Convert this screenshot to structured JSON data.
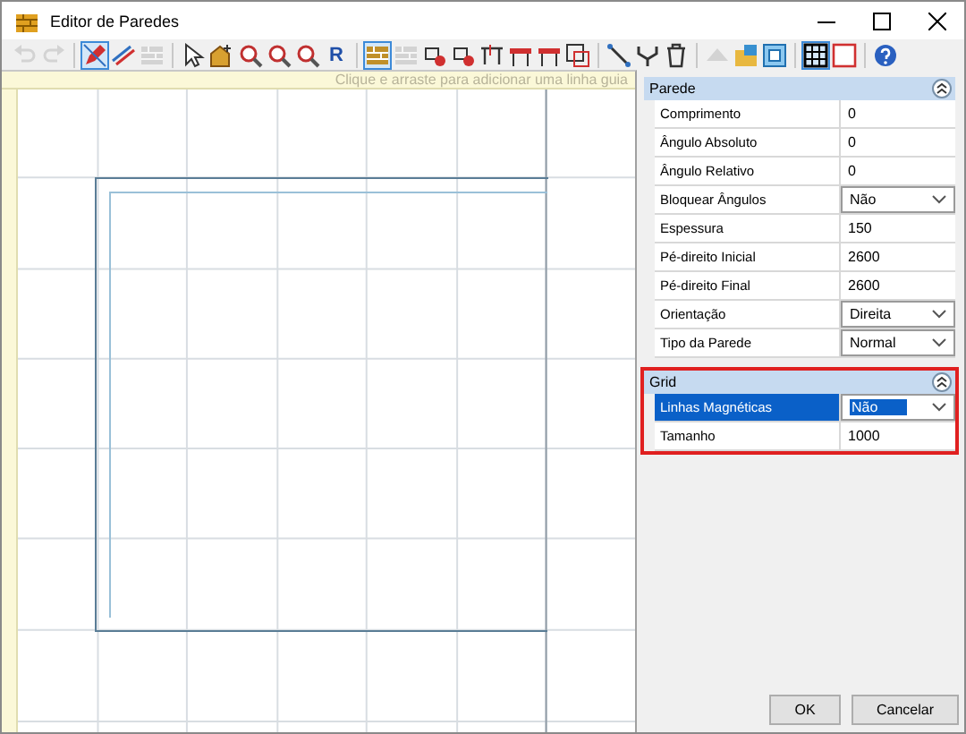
{
  "window": {
    "title": "Editor de Paredes"
  },
  "toolbar": [
    {
      "selected": false,
      "disabled": true
    },
    {
      "selected": false,
      "disabled": true
    },
    {
      "selected": true,
      "disabled": false
    },
    {
      "selected": false,
      "disabled": false
    },
    {
      "selected": false,
      "disabled": true
    },
    {
      "selected": false,
      "disabled": false
    },
    {
      "selected": false,
      "disabled": false
    },
    {
      "selected": false,
      "disabled": false
    },
    {
      "selected": false,
      "disabled": false
    },
    {
      "selected": false,
      "disabled": false
    },
    {
      "selected": false,
      "disabled": false,
      "label": "R"
    },
    {
      "selected": true,
      "disabled": false
    },
    {
      "selected": false,
      "disabled": true
    },
    {
      "selected": false,
      "disabled": false
    },
    {
      "selected": false,
      "disabled": false
    },
    {
      "selected": false,
      "disabled": false
    },
    {
      "selected": false,
      "disabled": false
    },
    {
      "selected": false,
      "disabled": false
    },
    {
      "selected": false,
      "disabled": false
    },
    {
      "selected": false,
      "disabled": false
    },
    {
      "selected": false,
      "disabled": false
    },
    {
      "selected": false,
      "disabled": false
    },
    {
      "selected": false,
      "disabled": true
    },
    {
      "selected": false,
      "disabled": false
    },
    {
      "selected": false,
      "disabled": false
    },
    {
      "selected": true,
      "disabled": false
    },
    {
      "selected": false,
      "disabled": false
    },
    {
      "selected": false,
      "disabled": false
    }
  ],
  "canvas": {
    "hint": "Clique e arraste para adicionar uma linha guia"
  },
  "properties": [
    {
      "title": "Parede",
      "expanded": true,
      "highlighted": false,
      "rows": [
        {
          "label": "Comprimento",
          "value": "0",
          "kind": "text",
          "selected": false
        },
        {
          "label": "Ângulo Absoluto",
          "value": "0",
          "kind": "text",
          "selected": false
        },
        {
          "label": "Ângulo Relativo",
          "value": "0",
          "kind": "text",
          "selected": false
        },
        {
          "label": "Bloquear Ângulos",
          "value": "Não",
          "kind": "dropdown",
          "selected": false
        },
        {
          "label": "Espessura",
          "value": "150",
          "kind": "text",
          "selected": false
        },
        {
          "label": "Pé-direito Inicial",
          "value": "2600",
          "kind": "text",
          "selected": false
        },
        {
          "label": "Pé-direito Final",
          "value": "2600",
          "kind": "text",
          "selected": false
        },
        {
          "label": "Orientação",
          "value": "Direita",
          "kind": "dropdown",
          "selected": false
        },
        {
          "label": "Tipo da Parede",
          "value": "Normal",
          "kind": "dropdown",
          "selected": false
        }
      ]
    },
    {
      "title": "Grid",
      "expanded": true,
      "highlighted": true,
      "rows": [
        {
          "label": "Linhas Magnéticas",
          "value": "Não",
          "kind": "dropdown",
          "selected": true
        },
        {
          "label": "Tamanho",
          "value": "1000",
          "kind": "text",
          "selected": false
        }
      ]
    }
  ],
  "buttons": [
    "OK",
    "Cancelar"
  ]
}
